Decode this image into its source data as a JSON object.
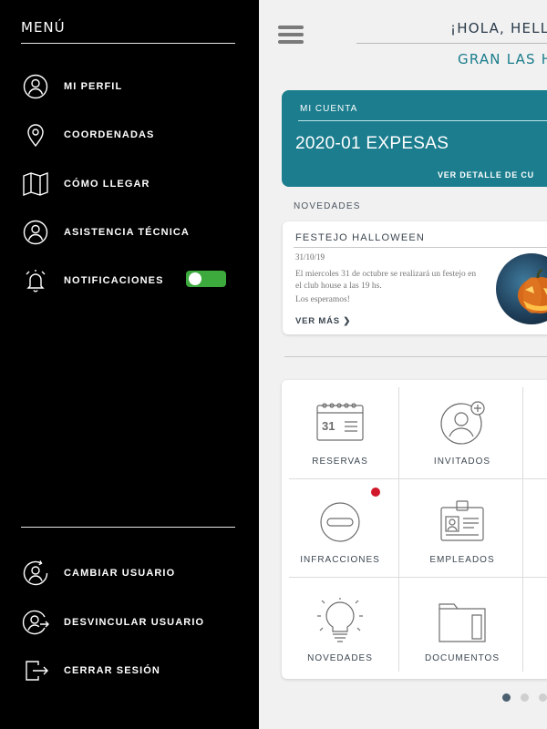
{
  "sidebar": {
    "title": "MENÚ",
    "top_items": [
      {
        "label": "MI PERFIL",
        "icon": "user-circle-icon"
      },
      {
        "label": "COORDENADAS",
        "icon": "map-pin-icon"
      },
      {
        "label": "CÓMO LLEGAR",
        "icon": "map-icon"
      },
      {
        "label": "ASISTENCIA TÉCNICA",
        "icon": "user-circle-icon"
      },
      {
        "label": "NOTIFICACIONES",
        "icon": "bell-alarm-icon"
      }
    ],
    "notifications_toggle": {
      "on": true,
      "color": "#3caa3c"
    },
    "bottom_items": [
      {
        "label": "CAMBIAR USUARIO",
        "icon": "user-switch-icon"
      },
      {
        "label": "DESVINCULAR USUARIO",
        "icon": "user-unlink-icon"
      },
      {
        "label": "CERRAR SESIÓN",
        "icon": "logout-icon"
      }
    ]
  },
  "header": {
    "greeting": "¡HOLA, HELL",
    "subtitle": "GRAN LAS H"
  },
  "account": {
    "label": "MI CUENTA",
    "value": "2020-01 EXPESAS",
    "link": "VER DETALLE DE CU",
    "color": "#1b7d8e"
  },
  "news": {
    "section_title": "NOVEDADES",
    "title": "FESTEJO HALLOWEEN",
    "date": "31/10/19",
    "body_1": "El miercoles 31 de octubre se realizará un festejo en el club house a las 19 hs.",
    "body_2": "Los esperamos!",
    "more": "VER MÁS",
    "image_icon": "halloween-pumpkin-image"
  },
  "grid": {
    "tiles": [
      {
        "label": "RESERVAS",
        "icon": "calendar-icon"
      },
      {
        "label": "INVITADOS",
        "icon": "add-guest-icon"
      },
      {
        "label": "INFRACCIONES",
        "icon": "no-entry-icon",
        "alert": true
      },
      {
        "label": "EMPLEADOS",
        "icon": "id-badge-icon"
      },
      {
        "label": "NOVEDADES",
        "icon": "lightbulb-icon"
      },
      {
        "label": "DOCUMENTOS",
        "icon": "folder-icon"
      }
    ],
    "calendar_day": "31",
    "alert_color": "#d0182a"
  },
  "pager": {
    "pages": 3,
    "active": 1
  }
}
